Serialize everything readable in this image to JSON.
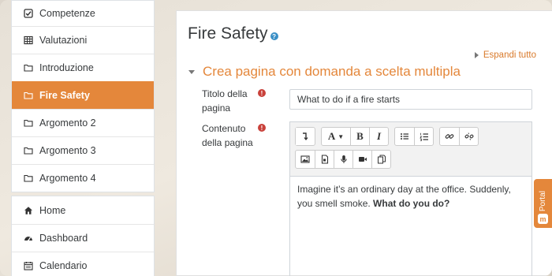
{
  "sidebar": {
    "course_items": [
      {
        "label": "Competenze",
        "icon": "checkbox-icon"
      },
      {
        "label": "Valutazioni",
        "icon": "table-icon"
      },
      {
        "label": "Introduzione",
        "icon": "folder-icon"
      },
      {
        "label": "Fire Safety",
        "icon": "folder-icon",
        "active": true
      },
      {
        "label": "Argomento 2",
        "icon": "folder-icon"
      },
      {
        "label": "Argomento 3",
        "icon": "folder-icon"
      },
      {
        "label": "Argomento 4",
        "icon": "folder-icon"
      }
    ],
    "site_items": [
      {
        "label": "Home",
        "icon": "home-icon"
      },
      {
        "label": "Dashboard",
        "icon": "dashboard-icon"
      },
      {
        "label": "Calendario",
        "icon": "calendar-icon"
      }
    ]
  },
  "main": {
    "title": "Fire Safety",
    "expand_all": "Espandi tutto",
    "section_title": "Crea pagina con domanda a scelta multipla",
    "page_title_label": "Titolo della pagina",
    "page_title_value": "What to do if a fire starts",
    "page_content_label": "Contenuto della pagina",
    "editor_text_plain": "Imagine it’s an ordinary day at the office. Suddenly, you smell smoke. ",
    "editor_text_bold": "What do you do?"
  },
  "toolbar": {
    "font_label": "A",
    "bold_label": "B",
    "italic_label": "I"
  },
  "portal": {
    "label": "Portal",
    "icon_letter": "m"
  },
  "colors": {
    "accent": "#e4873b",
    "required": "#c9413a",
    "help": "#3a8fc6"
  }
}
